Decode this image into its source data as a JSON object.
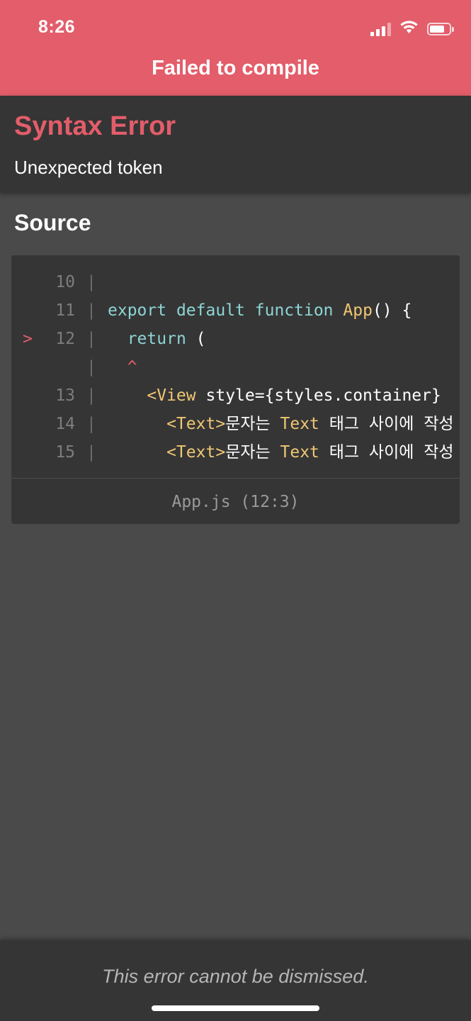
{
  "status_bar": {
    "time": "8:26",
    "icons": [
      "cellular-signal-icon",
      "wifi-icon",
      "battery-icon"
    ]
  },
  "header": {
    "title": "Failed to compile"
  },
  "error": {
    "type": "Syntax Error",
    "message": "Unexpected token"
  },
  "source": {
    "title": "Source",
    "lines": [
      {
        "marker": "",
        "number": "10",
        "pipe": "|"
      },
      {
        "marker": "",
        "number": "11",
        "pipe": "|",
        "tokens": {
          "t1": "export",
          "t2": "default",
          "t3": "function",
          "t4": "App",
          "t5": "() {"
        }
      },
      {
        "marker": ">",
        "number": "12",
        "pipe": "|",
        "tokens": {
          "t1": "return",
          "t2": "("
        }
      },
      {
        "marker": "",
        "number": "",
        "pipe": "|",
        "caret": "^"
      },
      {
        "marker": "",
        "number": "13",
        "pipe": "|",
        "tokens": {
          "t1": "<View",
          "t2": "style={styles.container}"
        }
      },
      {
        "marker": "",
        "number": "14",
        "pipe": "|",
        "tokens": {
          "t1": "<Text>",
          "t2": "문자는 ",
          "t3": "Text",
          "t4": " 태그 사이에 작성"
        }
      },
      {
        "marker": "",
        "number": "15",
        "pipe": "|",
        "tokens": {
          "t1": "<Text>",
          "t2": "문자는 ",
          "t3": "Text",
          "t4": " 태그 사이에 작성"
        }
      }
    ],
    "location": "App.js (12:3)"
  },
  "footer": {
    "message": "This error cannot be dismissed."
  },
  "colors": {
    "header_bg": "#e35d6a",
    "panel_bg": "#353535",
    "page_bg": "#4a4a4a",
    "error_accent": "#e35d6a",
    "keyword": "#8ed4d4",
    "identifier": "#f0c674"
  }
}
